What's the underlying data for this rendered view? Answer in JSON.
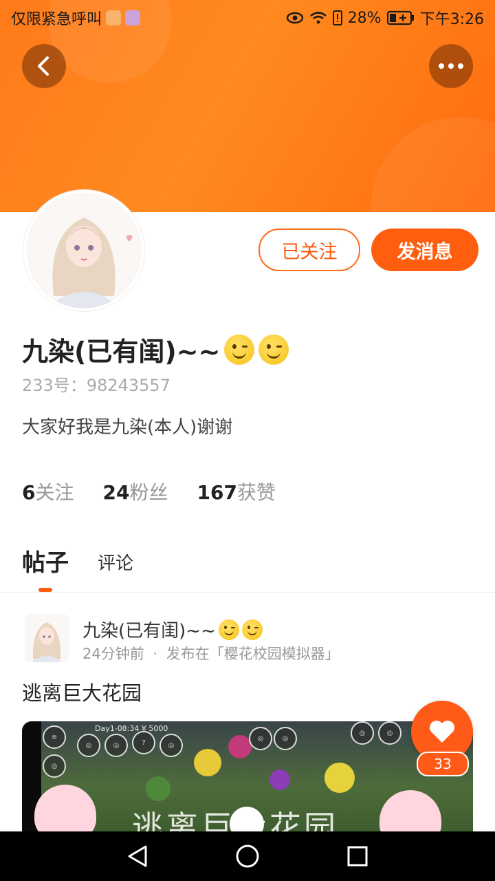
{
  "status_bar": {
    "carrier_text": "仅限紧急呼叫",
    "battery": "28%",
    "time": "下午3:26"
  },
  "profile": {
    "name": "九染(已有闺)~~",
    "uid_label": "233号：",
    "uid": "98243557",
    "bio": "大家好我是九染(本人)谢谢",
    "follow_button": "已关注",
    "message_button": "发消息"
  },
  "stats": {
    "following_count": "6",
    "following_label": "关注",
    "fans_count": "24",
    "fans_label": "粉丝",
    "likes_count": "167",
    "likes_label": "获赞"
  },
  "tabs": {
    "posts": "帖子",
    "comments": "评论"
  },
  "post": {
    "author": "九染(已有闺)~~",
    "time_ago": "24分钟前",
    "separator": "·",
    "published_in": "发布在「樱花校园模拟器」",
    "title": "逃离巨大花园",
    "video_caption": "逃离巨大花园",
    "video_hud_day": "Day1-08:34  ¥ 5000",
    "like_count": "33"
  },
  "icons": {
    "back": "back-arrow-icon",
    "more": "more-dots-icon",
    "heart": "heart-icon",
    "nav_back": "triangle-back-icon",
    "nav_home": "circle-home-icon",
    "nav_recent": "square-recent-icon"
  },
  "colors": {
    "accent": "#ff5e0e",
    "header_orange": "#ff7a1a"
  }
}
